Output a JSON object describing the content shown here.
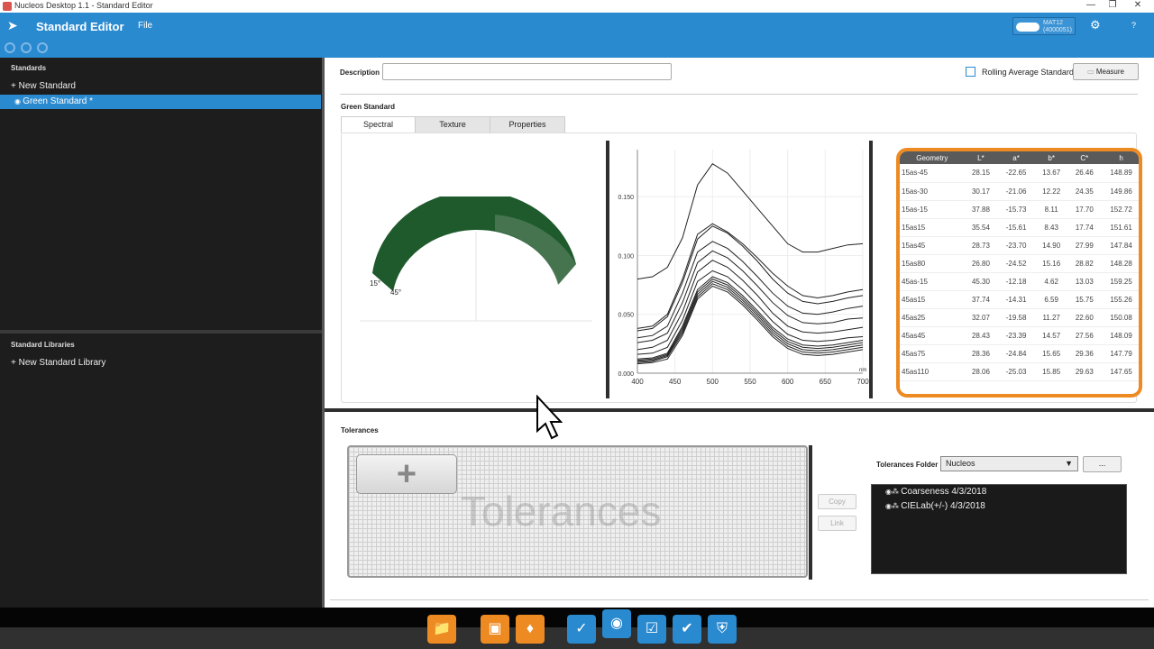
{
  "window": {
    "title": "Nucleos Desktop  1.1  - Standard Editor",
    "minimize": "—",
    "restore": "❐",
    "close": "✕"
  },
  "appbar": {
    "title": "Standard Editor",
    "file_menu": "File",
    "device_name": "MAT12",
    "device_id": "(4000051)",
    "help": "?"
  },
  "left_panel": {
    "standards_header": "Standards",
    "new_standard": "New Standard",
    "selected_standard": "Green Standard *",
    "libraries_header": "Standard Libraries",
    "new_library": "New Standard Library"
  },
  "editor": {
    "description_label": "Description",
    "description_value": "",
    "rolling_average_label": "Rolling Average Standard",
    "rolling_average_checked": false,
    "measure_button": "Measure",
    "standard_name": "Green Standard",
    "tabs": [
      "Spectral",
      "Texture",
      "Properties"
    ],
    "active_tab": "Spectral"
  },
  "geometry_gauge": {
    "label_a": "15°",
    "label_b": "45°",
    "color": "#1e5a2c"
  },
  "chart_data": {
    "type": "line",
    "x_ticks": [
      "400",
      "450",
      "500",
      "550",
      "600",
      "650",
      "700"
    ],
    "y_ticks": [
      "0.000",
      "0.050",
      "0.100",
      "0.150"
    ],
    "x_unit": "nm",
    "xlim": [
      400,
      700
    ],
    "ylim": [
      0,
      0.19
    ],
    "x": [
      400,
      420,
      440,
      460,
      480,
      500,
      520,
      540,
      560,
      580,
      600,
      620,
      640,
      660,
      680,
      700
    ],
    "series": [
      {
        "values": [
          0.08,
          0.082,
          0.09,
          0.115,
          0.16,
          0.178,
          0.17,
          0.155,
          0.14,
          0.125,
          0.11,
          0.103,
          0.103,
          0.106,
          0.109,
          0.11
        ]
      },
      {
        "values": [
          0.038,
          0.04,
          0.05,
          0.08,
          0.118,
          0.127,
          0.12,
          0.11,
          0.098,
          0.085,
          0.074,
          0.066,
          0.064,
          0.066,
          0.069,
          0.071
        ]
      },
      {
        "values": [
          0.036,
          0.038,
          0.048,
          0.077,
          0.114,
          0.125,
          0.119,
          0.108,
          0.095,
          0.08,
          0.068,
          0.061,
          0.059,
          0.061,
          0.064,
          0.066
        ]
      },
      {
        "values": [
          0.03,
          0.032,
          0.04,
          0.068,
          0.103,
          0.112,
          0.106,
          0.095,
          0.082,
          0.068,
          0.057,
          0.051,
          0.05,
          0.052,
          0.055,
          0.057
        ]
      },
      {
        "values": [
          0.026,
          0.028,
          0.034,
          0.06,
          0.094,
          0.104,
          0.098,
          0.087,
          0.074,
          0.06,
          0.049,
          0.043,
          0.042,
          0.043,
          0.046,
          0.047
        ]
      },
      {
        "values": [
          0.02,
          0.022,
          0.028,
          0.052,
          0.086,
          0.096,
          0.09,
          0.079,
          0.066,
          0.051,
          0.04,
          0.035,
          0.034,
          0.035,
          0.037,
          0.039
        ]
      },
      {
        "values": [
          0.016,
          0.017,
          0.022,
          0.045,
          0.078,
          0.087,
          0.082,
          0.071,
          0.058,
          0.044,
          0.033,
          0.028,
          0.027,
          0.028,
          0.03,
          0.031
        ]
      },
      {
        "values": [
          0.012,
          0.013,
          0.017,
          0.04,
          0.071,
          0.082,
          0.077,
          0.066,
          0.053,
          0.039,
          0.029,
          0.024,
          0.023,
          0.024,
          0.026,
          0.028
        ]
      },
      {
        "values": [
          0.011,
          0.012,
          0.016,
          0.038,
          0.069,
          0.08,
          0.075,
          0.064,
          0.051,
          0.037,
          0.027,
          0.022,
          0.021,
          0.022,
          0.024,
          0.026
        ]
      },
      {
        "values": [
          0.01,
          0.011,
          0.015,
          0.036,
          0.067,
          0.078,
          0.073,
          0.062,
          0.049,
          0.035,
          0.025,
          0.02,
          0.019,
          0.02,
          0.022,
          0.024
        ]
      },
      {
        "values": [
          0.009,
          0.01,
          0.014,
          0.034,
          0.065,
          0.076,
          0.071,
          0.06,
          0.047,
          0.033,
          0.023,
          0.018,
          0.017,
          0.018,
          0.02,
          0.022
        ]
      },
      {
        "values": [
          0.008,
          0.009,
          0.012,
          0.032,
          0.063,
          0.074,
          0.069,
          0.058,
          0.045,
          0.031,
          0.021,
          0.016,
          0.015,
          0.016,
          0.018,
          0.02
        ]
      }
    ]
  },
  "measurements": {
    "columns": [
      "Geometry",
      "L*",
      "a*",
      "b*",
      "C*",
      "h"
    ],
    "rows": [
      [
        "15as-45",
        "28.15",
        "-22.65",
        "13.67",
        "26.46",
        "148.89"
      ],
      [
        "15as-30",
        "30.17",
        "-21.06",
        "12.22",
        "24.35",
        "149.86"
      ],
      [
        "15as-15",
        "37.88",
        "-15.73",
        "8.11",
        "17.70",
        "152.72"
      ],
      [
        "15as15",
        "35.54",
        "-15.61",
        "8.43",
        "17.74",
        "151.61"
      ],
      [
        "15as45",
        "28.73",
        "-23.70",
        "14.90",
        "27.99",
        "147.84"
      ],
      [
        "15as80",
        "26.80",
        "-24.52",
        "15.16",
        "28.82",
        "148.28"
      ],
      [
        "45as-15",
        "45.30",
        "-12.18",
        "4.62",
        "13.03",
        "159.25"
      ],
      [
        "45as15",
        "37.74",
        "-14.31",
        "6.59",
        "15.75",
        "155.26"
      ],
      [
        "45as25",
        "32.07",
        "-19.58",
        "11.27",
        "22.60",
        "150.08"
      ],
      [
        "45as45",
        "28.43",
        "-23.39",
        "14.57",
        "27.56",
        "148.09"
      ],
      [
        "45as75",
        "28.36",
        "-24.84",
        "15.65",
        "29.36",
        "147.79"
      ],
      [
        "45as110",
        "28.06",
        "-25.03",
        "15.85",
        "29.63",
        "147.65"
      ]
    ],
    "highlight_color": "#ee8a22"
  },
  "tolerances": {
    "header": "Tolerances",
    "add_label": "+",
    "watermark": "Tolerances",
    "copy_button": "Copy",
    "link_button": "Link",
    "folder_label": "Tolerances Folder",
    "folder_value": "Nucleos",
    "browse_button": "...",
    "items": [
      "Coarseness 4/3/2018",
      "CIELab(+/-) 4/3/2018"
    ]
  },
  "taskbar": {
    "icons": [
      "folder-icon",
      "package-icon",
      "tag-icon",
      "verify-icon",
      "measure-icon",
      "check-box-icon",
      "check-icon",
      "shield-check-icon"
    ]
  }
}
